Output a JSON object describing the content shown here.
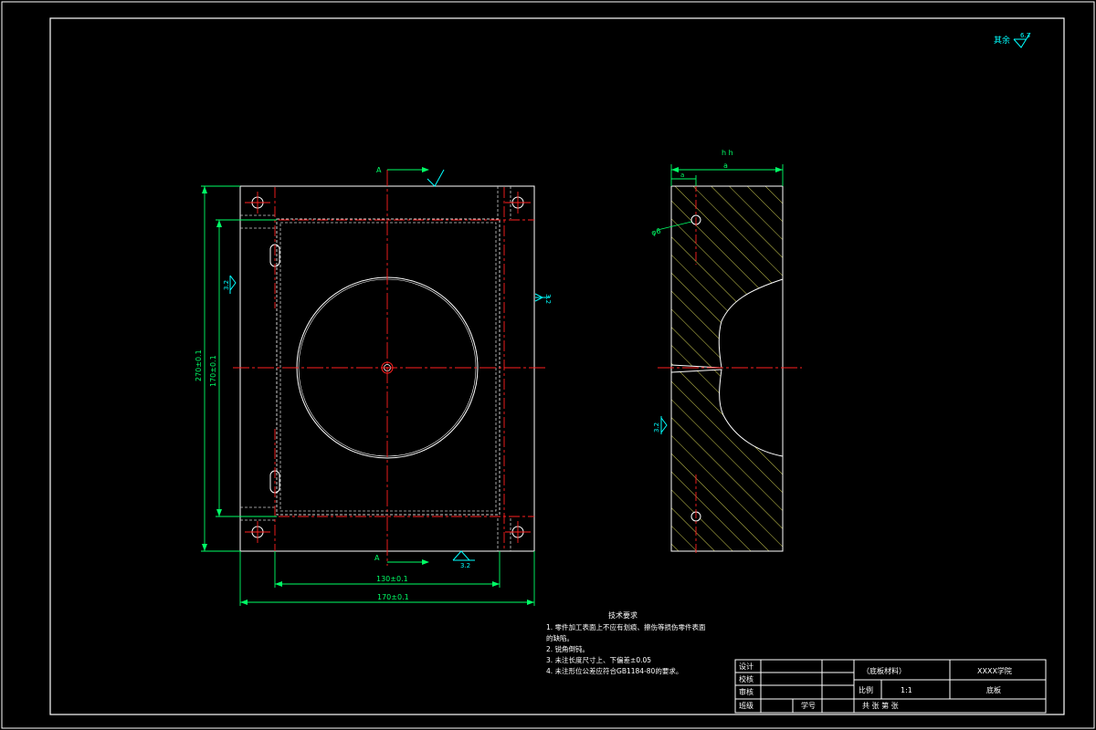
{
  "colors": {
    "background": "#000000",
    "outline": "#ffffff",
    "centerline": "#ff2020",
    "dimension": "#00ff66",
    "hatch": "#ffff66",
    "symbol": "#00ffff",
    "hidden": "#cccccc"
  },
  "corner_roughness": {
    "label": "其余",
    "value": "6.3"
  },
  "front_view": {
    "section_label_top": "A",
    "section_label_bottom": "A",
    "dim_height_outer": "270±0.1",
    "dim_height_inner": "170±0.1",
    "dim_width_inner": "130±0.1",
    "dim_width_outer": "170±0.1",
    "roughness_left": "3.2",
    "roughness_right": "3.2",
    "roughness_bottom": "3.2"
  },
  "side_view": {
    "dim_top_total": "h h",
    "dim_top_a": "a",
    "dim_top_b": "a",
    "dim_hole": "φ6",
    "roughness_left": "3.2"
  },
  "tech_requirements": {
    "title": "技术要求",
    "items": [
      "1. 零件加工表面上不应有划痕、擦伤等损伤零件表面",
      "   的缺陷。",
      "2. 锐角倒钝。",
      "3. 未注长度尺寸上、下偏差±0.05",
      "4. 未注形位公差应符合GB1184-80的要求。"
    ]
  },
  "title_block": {
    "row_labels": [
      "设计",
      "校核",
      "审核",
      "班级"
    ],
    "student_no_label": "学号",
    "material": "（底板材料）",
    "school": "XXXX学院",
    "scale_label": "比例",
    "scale_value": "1:1",
    "part_name": "底板",
    "sheet_info": "共  张  第  张"
  }
}
